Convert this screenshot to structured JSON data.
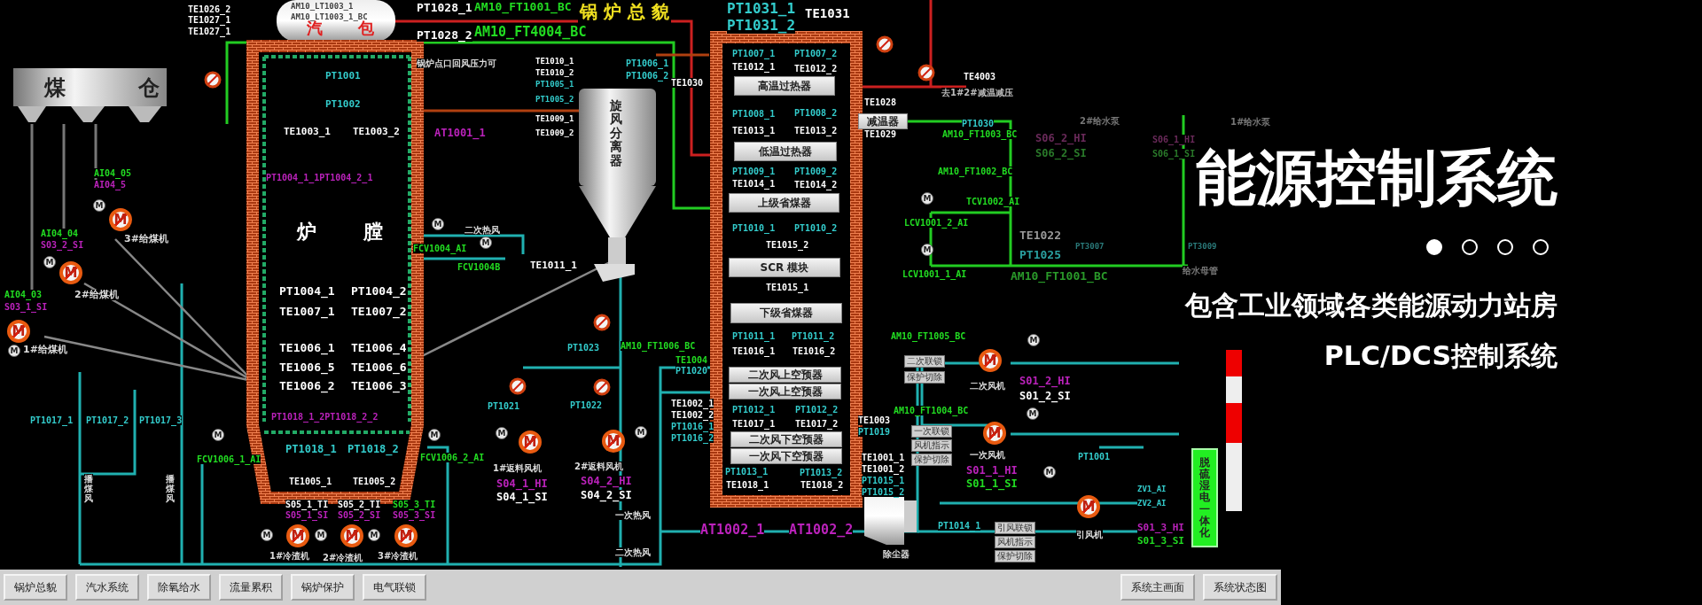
{
  "title": "锅 炉 总 貌",
  "tags": [
    {
      "text": "TE1026_2",
      "color": "#ffffff"
    },
    {
      "text": "TE1027_1",
      "color": "#ffffff"
    },
    {
      "text": "TE1027_1",
      "color": "#ffffff"
    },
    {
      "text": "AM10_LT1003_1",
      "color": "#404040"
    },
    {
      "text": "AM10_LT1003_1_BC",
      "color": "#404040"
    },
    {
      "text": "PT1028_1",
      "color": "#ffffff"
    },
    {
      "text": "AM10_FT1001_BC",
      "color": "#22dd22"
    },
    {
      "text": "PT1028_2",
      "color": "#ffffff"
    },
    {
      "text": "AM10_FT4004_BC",
      "color": "#22dd22"
    },
    {
      "text": "PT1001",
      "color": "#33cccc"
    },
    {
      "text": "PT1002",
      "color": "#33cccc"
    },
    {
      "text": "TE1003_1",
      "color": "#ffffff"
    },
    {
      "text": "TE1003_2",
      "color": "#ffffff"
    },
    {
      "text": "PT1004_1_1PT1004_2_1",
      "color": "#bb22bb"
    },
    {
      "text": "AT1001_1",
      "color": "#bb22bb"
    },
    {
      "text": "AI04_05",
      "color": "#22dd22"
    },
    {
      "text": "AI04_5",
      "color": "#bb22bb"
    },
    {
      "text": "AI04_04",
      "color": "#22dd22"
    },
    {
      "text": "S03_2_SI",
      "color": "#bb22bb"
    },
    {
      "text": "AI04_03",
      "color": "#22dd22"
    },
    {
      "text": "S03_1_SI",
      "color": "#bb22bb"
    },
    {
      "text": "PT1004_1",
      "color": "#ffffff"
    },
    {
      "text": "PT1004_2",
      "color": "#ffffff"
    },
    {
      "text": "TE1007_1",
      "color": "#ffffff"
    },
    {
      "text": "TE1007_2",
      "color": "#ffffff"
    },
    {
      "text": "TE1006_1",
      "color": "#ffffff"
    },
    {
      "text": "TE1006_4",
      "color": "#ffffff"
    },
    {
      "text": "TE1006_5",
      "color": "#ffffff"
    },
    {
      "text": "TE1006_6",
      "color": "#ffffff"
    },
    {
      "text": "TE1006_2",
      "color": "#ffffff"
    },
    {
      "text": "TE1006_3",
      "color": "#ffffff"
    },
    {
      "text": "PT1018_1_2PT1018_2_2",
      "color": "#bb22bb"
    },
    {
      "text": "PT1018_1",
      "color": "#33cccc"
    },
    {
      "text": "PT1018_2",
      "color": "#33cccc"
    },
    {
      "text": "TE1005_1",
      "color": "#ffffff"
    },
    {
      "text": "TE1005_2",
      "color": "#ffffff"
    },
    {
      "text": "PT1017_1",
      "color": "#33cccc"
    },
    {
      "text": "PT1017_2",
      "color": "#33cccc"
    },
    {
      "text": "PT1017_3",
      "color": "#33cccc"
    },
    {
      "text": "FCV1006_1_AI",
      "color": "#22dd22"
    },
    {
      "text": "FCV1006_2_AI",
      "color": "#22dd22"
    },
    {
      "text": "S05_1_TI",
      "color": "#ffffff"
    },
    {
      "text": "S05_1_SI",
      "color": "#bb22bb"
    },
    {
      "text": "S05_2_TI",
      "color": "#ffffff"
    },
    {
      "text": "S05_2_SI",
      "color": "#bb22bb"
    },
    {
      "text": "S05_3_TI",
      "color": "#22dd22"
    },
    {
      "text": "S05_3_SI",
      "color": "#bb22bb"
    },
    {
      "text": "FCV1004_AI",
      "color": "#22dd22"
    },
    {
      "text": "FCV1004B",
      "color": "#22dd22"
    },
    {
      "text": "TE1010_1",
      "color": "#ffffff"
    },
    {
      "text": "TE1010_2",
      "color": "#ffffff"
    },
    {
      "text": "PT1005_1",
      "color": "#33cccc"
    },
    {
      "text": "PT1005_2",
      "color": "#33cccc"
    },
    {
      "text": "TE1009_1",
      "color": "#ffffff"
    },
    {
      "text": "TE1009_2",
      "color": "#ffffff"
    },
    {
      "text": "TE1011_1",
      "color": "#ffffff"
    },
    {
      "text": "PT1006_1",
      "color": "#33cccc"
    },
    {
      "text": "PT1006_2",
      "color": "#33cccc"
    },
    {
      "text": "TE1030",
      "color": "#ffffff"
    },
    {
      "text": "PT1031_1",
      "color": "#33cccc"
    },
    {
      "text": "PT1031_2",
      "color": "#33cccc"
    },
    {
      "text": "TE1031",
      "color": "#ffffff"
    },
    {
      "text": "PT1007_1",
      "color": "#33cccc"
    },
    {
      "text": "PT1007_2",
      "color": "#33cccc"
    },
    {
      "text": "TE1012_1",
      "color": "#ffffff"
    },
    {
      "text": "TE1012_2",
      "color": "#ffffff"
    },
    {
      "text": "PT1008_1",
      "color": "#33cccc"
    },
    {
      "text": "PT1008_2",
      "color": "#33cccc"
    },
    {
      "text": "TE1013_1",
      "color": "#ffffff"
    },
    {
      "text": "TE1013_2",
      "color": "#ffffff"
    },
    {
      "text": "PT1009_1",
      "color": "#33cccc"
    },
    {
      "text": "PT1009_2",
      "color": "#33cccc"
    },
    {
      "text": "TE1014_1",
      "color": "#ffffff"
    },
    {
      "text": "TE1014_2",
      "color": "#ffffff"
    },
    {
      "text": "PT1010_1",
      "color": "#33cccc"
    },
    {
      "text": "PT1010_2",
      "color": "#33cccc"
    },
    {
      "text": "TE1015_2",
      "color": "#ffffff"
    },
    {
      "text": "TE1015_1",
      "color": "#ffffff"
    },
    {
      "text": "PT1011_1",
      "color": "#33cccc"
    },
    {
      "text": "PT1011_2",
      "color": "#33cccc"
    },
    {
      "text": "TE1016_1",
      "color": "#ffffff"
    },
    {
      "text": "TE1016_2",
      "color": "#ffffff"
    },
    {
      "text": "PT1012_1",
      "color": "#33cccc"
    },
    {
      "text": "PT1012_2",
      "color": "#33cccc"
    },
    {
      "text": "TE1017_1",
      "color": "#ffffff"
    },
    {
      "text": "TE1017_2",
      "color": "#ffffff"
    },
    {
      "text": "PT1013_1",
      "color": "#33cccc"
    },
    {
      "text": "PT1013_2",
      "color": "#33cccc"
    },
    {
      "text": "TE1018_1",
      "color": "#ffffff"
    },
    {
      "text": "TE1018_2",
      "color": "#ffffff"
    },
    {
      "text": "TE1028",
      "color": "#ffffff"
    },
    {
      "text": "TE1029",
      "color": "#ffffff"
    },
    {
      "text": "TE4003",
      "color": "#ffffff"
    },
    {
      "text": "PT1030",
      "color": "#33cccc"
    },
    {
      "text": "AM10_FT1003_BC",
      "color": "#22dd22"
    },
    {
      "text": "S06_2_HI",
      "color": "#6a2a5a"
    },
    {
      "text": "S06_2_SI",
      "color": "#2a7a2a"
    },
    {
      "text": "AM10_FT1002_BC",
      "color": "#22dd22"
    },
    {
      "text": "TCV1002_AI",
      "color": "#22dd22"
    },
    {
      "text": "LCV1001_2_AI",
      "color": "#22dd22"
    },
    {
      "text": "TE1022",
      "color": "#999999"
    },
    {
      "text": "PT1025",
      "color": "#2aa0a0"
    },
    {
      "text": "PT3007",
      "color": "#2a7a7a"
    },
    {
      "text": "LCV1001_1_AI",
      "color": "#22dd22"
    },
    {
      "text": "AM10_FT1001_BC",
      "color": "#2a9a2a"
    },
    {
      "text": "S06_1_HI",
      "color": "#6a2a5a"
    },
    {
      "text": "S06_1_SI",
      "color": "#2a7a2a"
    },
    {
      "text": "PT3009",
      "color": "#2a7a7a"
    },
    {
      "text": "PT1023",
      "color": "#33cccc"
    },
    {
      "text": "AM10_FT1006_BC",
      "color": "#22dd22"
    },
    {
      "text": "TE1004",
      "color": "#22dd22"
    },
    {
      "text": "PT1020",
      "color": "#33cccc"
    },
    {
      "text": "PT1021",
      "color": "#33cccc"
    },
    {
      "text": "PT1022",
      "color": "#33cccc"
    },
    {
      "text": "S04_1_HI",
      "color": "#bb22bb"
    },
    {
      "text": "S04_1_SI",
      "color": "#ffffff"
    },
    {
      "text": "S04_2_HI",
      "color": "#bb22bb"
    },
    {
      "text": "S04_2_SI",
      "color": "#ffffff"
    },
    {
      "text": "TE1002_1",
      "color": "#ffffff"
    },
    {
      "text": "TE1002_2",
      "color": "#ffffff"
    },
    {
      "text": "PT1016_1",
      "color": "#33cccc"
    },
    {
      "text": "PT1016_2",
      "color": "#33cccc"
    },
    {
      "text": "AT1002_1",
      "color": "#bb22bb"
    },
    {
      "text": "AT1002_2",
      "color": "#bb22bb"
    },
    {
      "text": "TE1003",
      "color": "#ffffff"
    },
    {
      "text": "PT1019",
      "color": "#33cccc"
    },
    {
      "text": "TE1001_1",
      "color": "#ffffff"
    },
    {
      "text": "TE1001_2",
      "color": "#ffffff"
    },
    {
      "text": "PT1015_1",
      "color": "#33cccc"
    },
    {
      "text": "PT1015_2",
      "color": "#33cccc"
    },
    {
      "text": "AM10_FT1005_BC",
      "color": "#22dd22"
    },
    {
      "text": "AM10_FT1004_BC",
      "color": "#22dd22"
    },
    {
      "text": "S01_2_HI",
      "color": "#bb22bb"
    },
    {
      "text": "S01_2_SI",
      "color": "#ffffff"
    },
    {
      "text": "S01_1_HI",
      "color": "#bb22bb"
    },
    {
      "text": "S01_1_SI",
      "color": "#22dd22"
    },
    {
      "text": "PT1001",
      "color": "#33cccc"
    },
    {
      "text": "ZV1_AI",
      "color": "#33cccc"
    },
    {
      "text": "ZV2_AI",
      "color": "#33cccc"
    },
    {
      "text": "PT1014_1",
      "color": "#33cccc"
    },
    {
      "text": "S01_3_HI",
      "color": "#bb22bb"
    },
    {
      "text": "S01_3_SI",
      "color": "#22dd22"
    }
  ],
  "captions": [
    {
      "text": "汽",
      "color": "#e02020"
    },
    {
      "text": "包",
      "color": "#e02020"
    },
    {
      "text": "煤",
      "color": "#222222"
    },
    {
      "text": "仓",
      "color": "#222222"
    },
    {
      "text": "锅炉点口回风压力可",
      "color": "#dddddd"
    },
    {
      "text": "3#给煤机",
      "color": "#dddddd"
    },
    {
      "text": "2#给煤机",
      "color": "#dddddd"
    },
    {
      "text": "1#给煤机",
      "color": "#dddddd"
    },
    {
      "text": "炉",
      "color": "#ffffff"
    },
    {
      "text": "膛",
      "color": "#ffffff"
    },
    {
      "text": "二次热风",
      "color": "#dddddd"
    },
    {
      "text": "播煤风",
      "color": "#dddddd"
    },
    {
      "text": "播煤风",
      "color": "#dddddd"
    },
    {
      "text": "1#冷渣机",
      "color": "#dddddd"
    },
    {
      "text": "2#冷渣机",
      "color": "#dddddd"
    },
    {
      "text": "3#冷渣机",
      "color": "#dddddd"
    },
    {
      "text": "旋风分离器",
      "color": "#222222"
    },
    {
      "text": "1#返料风机",
      "color": "#dddddd"
    },
    {
      "text": "2#返料风机",
      "color": "#dddddd"
    },
    {
      "text": "一次热风",
      "color": "#dddddd"
    },
    {
      "text": "二次热风",
      "color": "#dddddd"
    },
    {
      "text": "去1#2#减温减压",
      "color": "#bbbbbb"
    },
    {
      "text": "2#给水泵",
      "color": "#777777"
    },
    {
      "text": "1#给水泵",
      "color": "#777777"
    },
    {
      "text": "给水母管",
      "color": "#777777"
    },
    {
      "text": "除尘器",
      "color": "#dddddd"
    },
    {
      "text": "二次风机",
      "color": "#dddddd"
    },
    {
      "text": "一次风机",
      "color": "#dddddd"
    },
    {
      "text": "引风机",
      "color": "#dddddd"
    }
  ],
  "plates": [
    "高温过热器",
    "低温过热器",
    "上级省煤器",
    "SCR 模块",
    "下级省煤器",
    "二次风上空预器",
    "一次风上空预器",
    "二次风下空预器",
    "一次风下空预器",
    "减温器"
  ],
  "control_plates": [
    "二次联锁",
    "保护切除",
    "一次联锁",
    "风机指示",
    "保护切除",
    "引风联锁",
    "风机指示",
    "保护切除"
  ],
  "desulfurization_label": "脱硫湿电一体化",
  "motors": [
    "M",
    "M",
    "M",
    "M",
    "M",
    "M",
    "M",
    "M",
    "M",
    "M",
    "M"
  ],
  "actuators": [
    "M",
    "M",
    "M",
    "M",
    "M",
    "M",
    "M",
    "M",
    "M",
    "M",
    "M",
    "M",
    "M",
    "M",
    "M",
    "M",
    "M"
  ],
  "nav_buttons": [
    "锅炉总貌",
    "汽水系统",
    "除氧给水",
    "流量累积",
    "锅炉保护",
    "电气联锁"
  ],
  "side_buttons": [
    "系统主画面",
    "系统状态图"
  ],
  "banner": {
    "headline": "能源控制系统",
    "dots": [
      {
        "selected": true
      },
      {
        "selected": false
      },
      {
        "selected": false
      },
      {
        "selected": false
      }
    ],
    "subtitle_lines": [
      "包含工业领域各类能源动力站房",
      "PLC/DCS控制系统"
    ]
  }
}
